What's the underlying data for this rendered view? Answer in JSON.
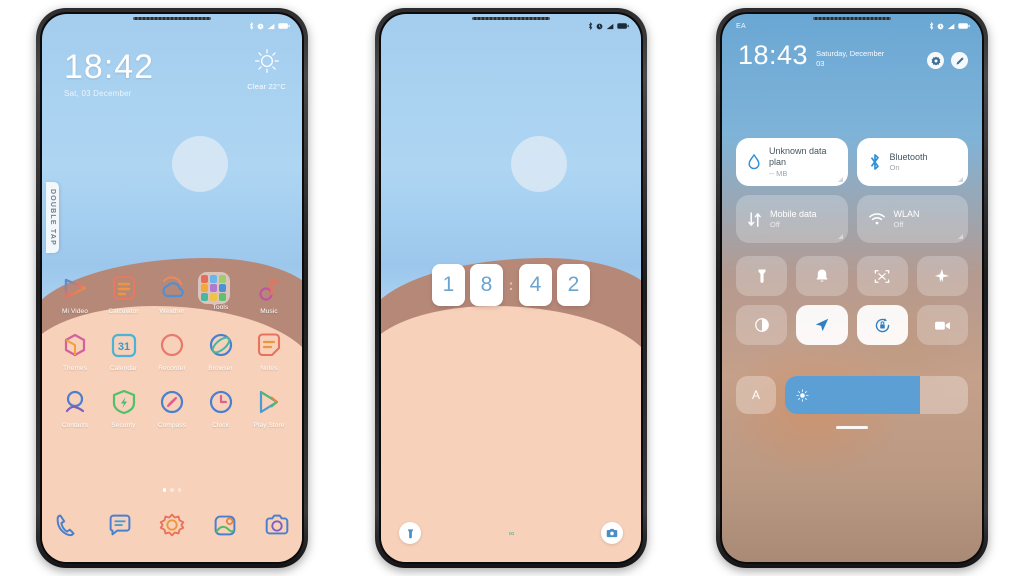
{
  "phone1": {
    "name": "home-screen",
    "statusbar": {
      "icons": [
        "bluetooth-icon",
        "alarm-icon",
        "signal-icon",
        "battery-icon"
      ]
    },
    "clock": {
      "time": "18:42",
      "date": "Sat, 03 December"
    },
    "weather": {
      "icon": "sun-icon",
      "text": "Clear  22°C"
    },
    "side_tab": {
      "label": "DOUBLE TAP"
    },
    "apps": [
      [
        {
          "label": "Mi Video",
          "icon": "mi-video-icon"
        },
        {
          "label": "Calculator",
          "icon": "calculator-icon"
        },
        {
          "label": "Weather",
          "icon": "weather-icon"
        },
        {
          "label": "Tools",
          "icon": "tools-folder-icon"
        },
        {
          "label": "Music",
          "icon": "music-icon"
        }
      ],
      [
        {
          "label": "Themes",
          "icon": "themes-icon"
        },
        {
          "label": "Calendar",
          "icon": "calendar-icon"
        },
        {
          "label": "Recorder",
          "icon": "recorder-icon"
        },
        {
          "label": "Browser",
          "icon": "browser-icon"
        },
        {
          "label": "Notes",
          "icon": "notes-icon"
        }
      ],
      [
        {
          "label": "Contacts",
          "icon": "contacts-icon"
        },
        {
          "label": "Security",
          "icon": "security-icon"
        },
        {
          "label": "Compass",
          "icon": "compass-icon"
        },
        {
          "label": "Clock",
          "icon": "clock-icon"
        },
        {
          "label": "Play Store",
          "icon": "play-store-icon"
        }
      ]
    ],
    "calendar_day": "31",
    "page_dots": {
      "count": 3,
      "active": 0
    },
    "dock": [
      {
        "label": "Phone",
        "icon": "phone-icon"
      },
      {
        "label": "Messages",
        "icon": "messages-icon"
      },
      {
        "label": "Settings",
        "icon": "settings-gear-icon"
      },
      {
        "label": "Gallery",
        "icon": "gallery-icon"
      },
      {
        "label": "Camera",
        "icon": "camera-icon"
      }
    ]
  },
  "phone2": {
    "name": "lock-screen",
    "statusbar": {
      "icons": [
        "bluetooth-icon",
        "alarm-icon",
        "signal-icon",
        "battery-icon"
      ]
    },
    "clock": {
      "digits": [
        "1",
        "8",
        "4",
        "2"
      ],
      "separator": ":"
    },
    "bottom": {
      "left_shortcut": "flashlight-icon",
      "right_shortcut": "camera-icon",
      "hint": "∞"
    }
  },
  "phone3": {
    "name": "control-center",
    "statusbar": {
      "carrier": "EA",
      "icons": [
        "bluetooth-icon",
        "alarm-icon",
        "signal-icon",
        "battery-icon"
      ]
    },
    "header": {
      "time": "18:43",
      "date": "Saturday, December 03",
      "settings_button": "gear-icon",
      "edit_button": "edit-pencil-icon"
    },
    "tiles": [
      {
        "title": "Unknown data plan",
        "sub": "-- MB",
        "icon": "data-drop-icon",
        "state": "on"
      },
      {
        "title": "Bluetooth",
        "sub": "On",
        "icon": "bluetooth-icon",
        "state": "on"
      },
      {
        "title": "Mobile data",
        "sub": "Off",
        "icon": "mobile-data-icon",
        "state": "off"
      },
      {
        "title": "WLAN",
        "sub": "Off",
        "icon": "wifi-icon",
        "state": "off"
      }
    ],
    "toggles": [
      {
        "name": "flashlight-icon",
        "state": "off"
      },
      {
        "name": "ringer-bell-icon",
        "state": "off"
      },
      {
        "name": "screenshot-icon",
        "state": "off"
      },
      {
        "name": "airplane-icon",
        "state": "off"
      },
      {
        "name": "dark-mode-icon",
        "state": "off"
      },
      {
        "name": "location-icon",
        "state": "on"
      },
      {
        "name": "auto-rotate-icon",
        "state": "on"
      },
      {
        "name": "screen-record-icon",
        "state": "off"
      }
    ],
    "brightness": {
      "auto_label": "A",
      "icon": "brightness-sun-icon",
      "level": 74
    }
  },
  "colors": {
    "sky_top": "#a4cdee",
    "sky_light": "#bfe1f7",
    "sand_front": "#f7d1ba",
    "sand_back": "#b68878",
    "accent_blue": "#5c9fd4",
    "digit_blue": "#6ba4cf",
    "tile_on_bg": "#ffffff"
  }
}
